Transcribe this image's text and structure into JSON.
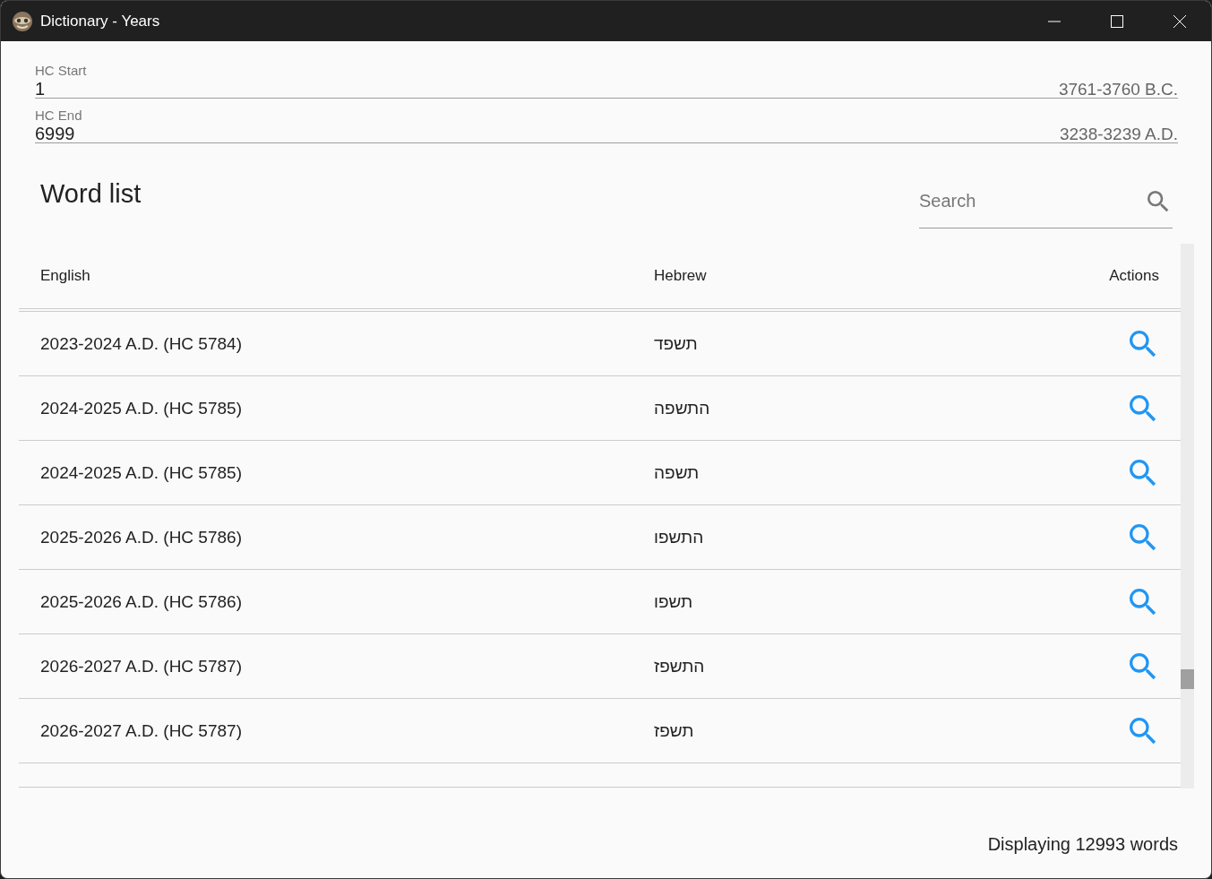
{
  "window": {
    "title": "Dictionary - Years"
  },
  "fields": [
    {
      "label": "HC Start",
      "value": "1",
      "hint": "3761-3760 B.C."
    },
    {
      "label": "HC End",
      "value": "6999",
      "hint": "3238-3239 A.D."
    }
  ],
  "word_list": {
    "title": "Word list",
    "search": {
      "placeholder": "Search"
    },
    "columns": [
      "English",
      "Hebrew",
      "Actions"
    ],
    "rows": [
      {
        "english": "2023-2024 A.D. (HC 5784)",
        "hebrew": "תשפד"
      },
      {
        "english": "2024-2025 A.D. (HC 5785)",
        "hebrew": "התשפה"
      },
      {
        "english": "2024-2025 A.D. (HC 5785)",
        "hebrew": "תשפה"
      },
      {
        "english": "2025-2026 A.D. (HC 5786)",
        "hebrew": "התשפו"
      },
      {
        "english": "2025-2026 A.D. (HC 5786)",
        "hebrew": "תשפו"
      },
      {
        "english": "2026-2027 A.D. (HC 5787)",
        "hebrew": "התשפז"
      },
      {
        "english": "2026-2027 A.D. (HC 5787)",
        "hebrew": "תשפז"
      }
    ]
  },
  "status_bar": {
    "text": "Displaying 12993 words"
  }
}
